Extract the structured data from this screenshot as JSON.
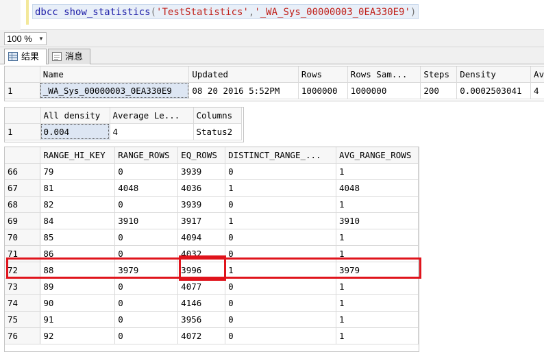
{
  "editor": {
    "kw1": "dbcc",
    "kw2": "show_statistics",
    "open": "(",
    "arg1": "'TestStatistics'",
    "comma": ",",
    "arg2": "'_WA_Sys_00000003_0EA330E9'",
    "close": ")"
  },
  "zoom": {
    "value": "100 %"
  },
  "tabs": [
    {
      "label": "结果",
      "icon": "grid-icon"
    },
    {
      "label": "消息",
      "icon": "messages-icon"
    }
  ],
  "header_grid": {
    "columns": [
      "Name",
      "Updated",
      "Rows",
      "Rows Sam...",
      "Steps",
      "Density",
      "Av"
    ],
    "rows": [
      {
        "n": "1",
        "cells": [
          "_WA_Sys_00000003_0EA330E9",
          "08 20 2016  5:52PM",
          "1000000",
          "1000000",
          "200",
          "0.0002503041",
          "4"
        ]
      }
    ]
  },
  "density_grid": {
    "columns": [
      "All density",
      "Average Le...",
      "Columns"
    ],
    "rows": [
      {
        "n": "1",
        "cells": [
          "0.004",
          "4",
          "Status2"
        ]
      }
    ]
  },
  "histogram_grid": {
    "columns": [
      "RANGE_HI_KEY",
      "RANGE_ROWS",
      "EQ_ROWS",
      "DISTINCT_RANGE_...",
      "AVG_RANGE_ROWS"
    ],
    "rows": [
      {
        "n": "66",
        "cells": [
          "79",
          "0",
          "3939",
          "0",
          "1"
        ]
      },
      {
        "n": "67",
        "cells": [
          "81",
          "4048",
          "4036",
          "1",
          "4048"
        ]
      },
      {
        "n": "68",
        "cells": [
          "82",
          "0",
          "3939",
          "0",
          "1"
        ]
      },
      {
        "n": "69",
        "cells": [
          "84",
          "3910",
          "3917",
          "1",
          "3910"
        ]
      },
      {
        "n": "70",
        "cells": [
          "85",
          "0",
          "4094",
          "0",
          "1"
        ]
      },
      {
        "n": "71",
        "cells": [
          "86",
          "0",
          "4032",
          "0",
          "1"
        ]
      },
      {
        "n": "72",
        "cells": [
          "88",
          "3979",
          "3996",
          "1",
          "3979"
        ]
      },
      {
        "n": "73",
        "cells": [
          "89",
          "0",
          "4077",
          "0",
          "1"
        ]
      },
      {
        "n": "74",
        "cells": [
          "90",
          "0",
          "4146",
          "0",
          "1"
        ]
      },
      {
        "n": "75",
        "cells": [
          "91",
          "0",
          "3956",
          "0",
          "1"
        ]
      },
      {
        "n": "76",
        "cells": [
          "92",
          "0",
          "4072",
          "0",
          "1"
        ]
      }
    ]
  },
  "colors": {
    "highlight": "#e0141c",
    "selection": "#dde6f3",
    "keyword": "#1a1aa6",
    "string": "#c0201a"
  }
}
